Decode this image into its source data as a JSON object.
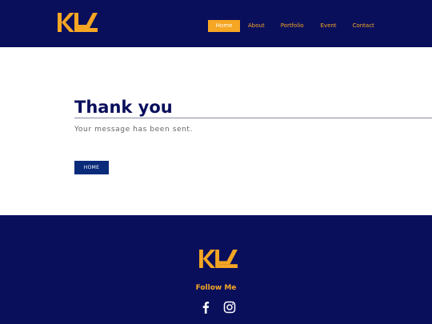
{
  "header": {
    "logo": "KL",
    "nav": [
      {
        "label": "Home",
        "active": true
      },
      {
        "label": "About",
        "active": false
      },
      {
        "label": "Portfolio",
        "active": false
      },
      {
        "label": "Event",
        "active": false
      },
      {
        "label": "Contact",
        "active": false
      }
    ]
  },
  "main": {
    "title": "Thank you",
    "message": "Your message has been sent.",
    "home_button": "HOME"
  },
  "footer": {
    "logo": "KL",
    "follow_label": "Follow Me",
    "social": [
      {
        "icon": "facebook-icon"
      },
      {
        "icon": "instagram-icon"
      }
    ]
  },
  "colors": {
    "navy": "#0a0f5c",
    "accent": "#f5a623",
    "button": "#0a2a7a"
  }
}
